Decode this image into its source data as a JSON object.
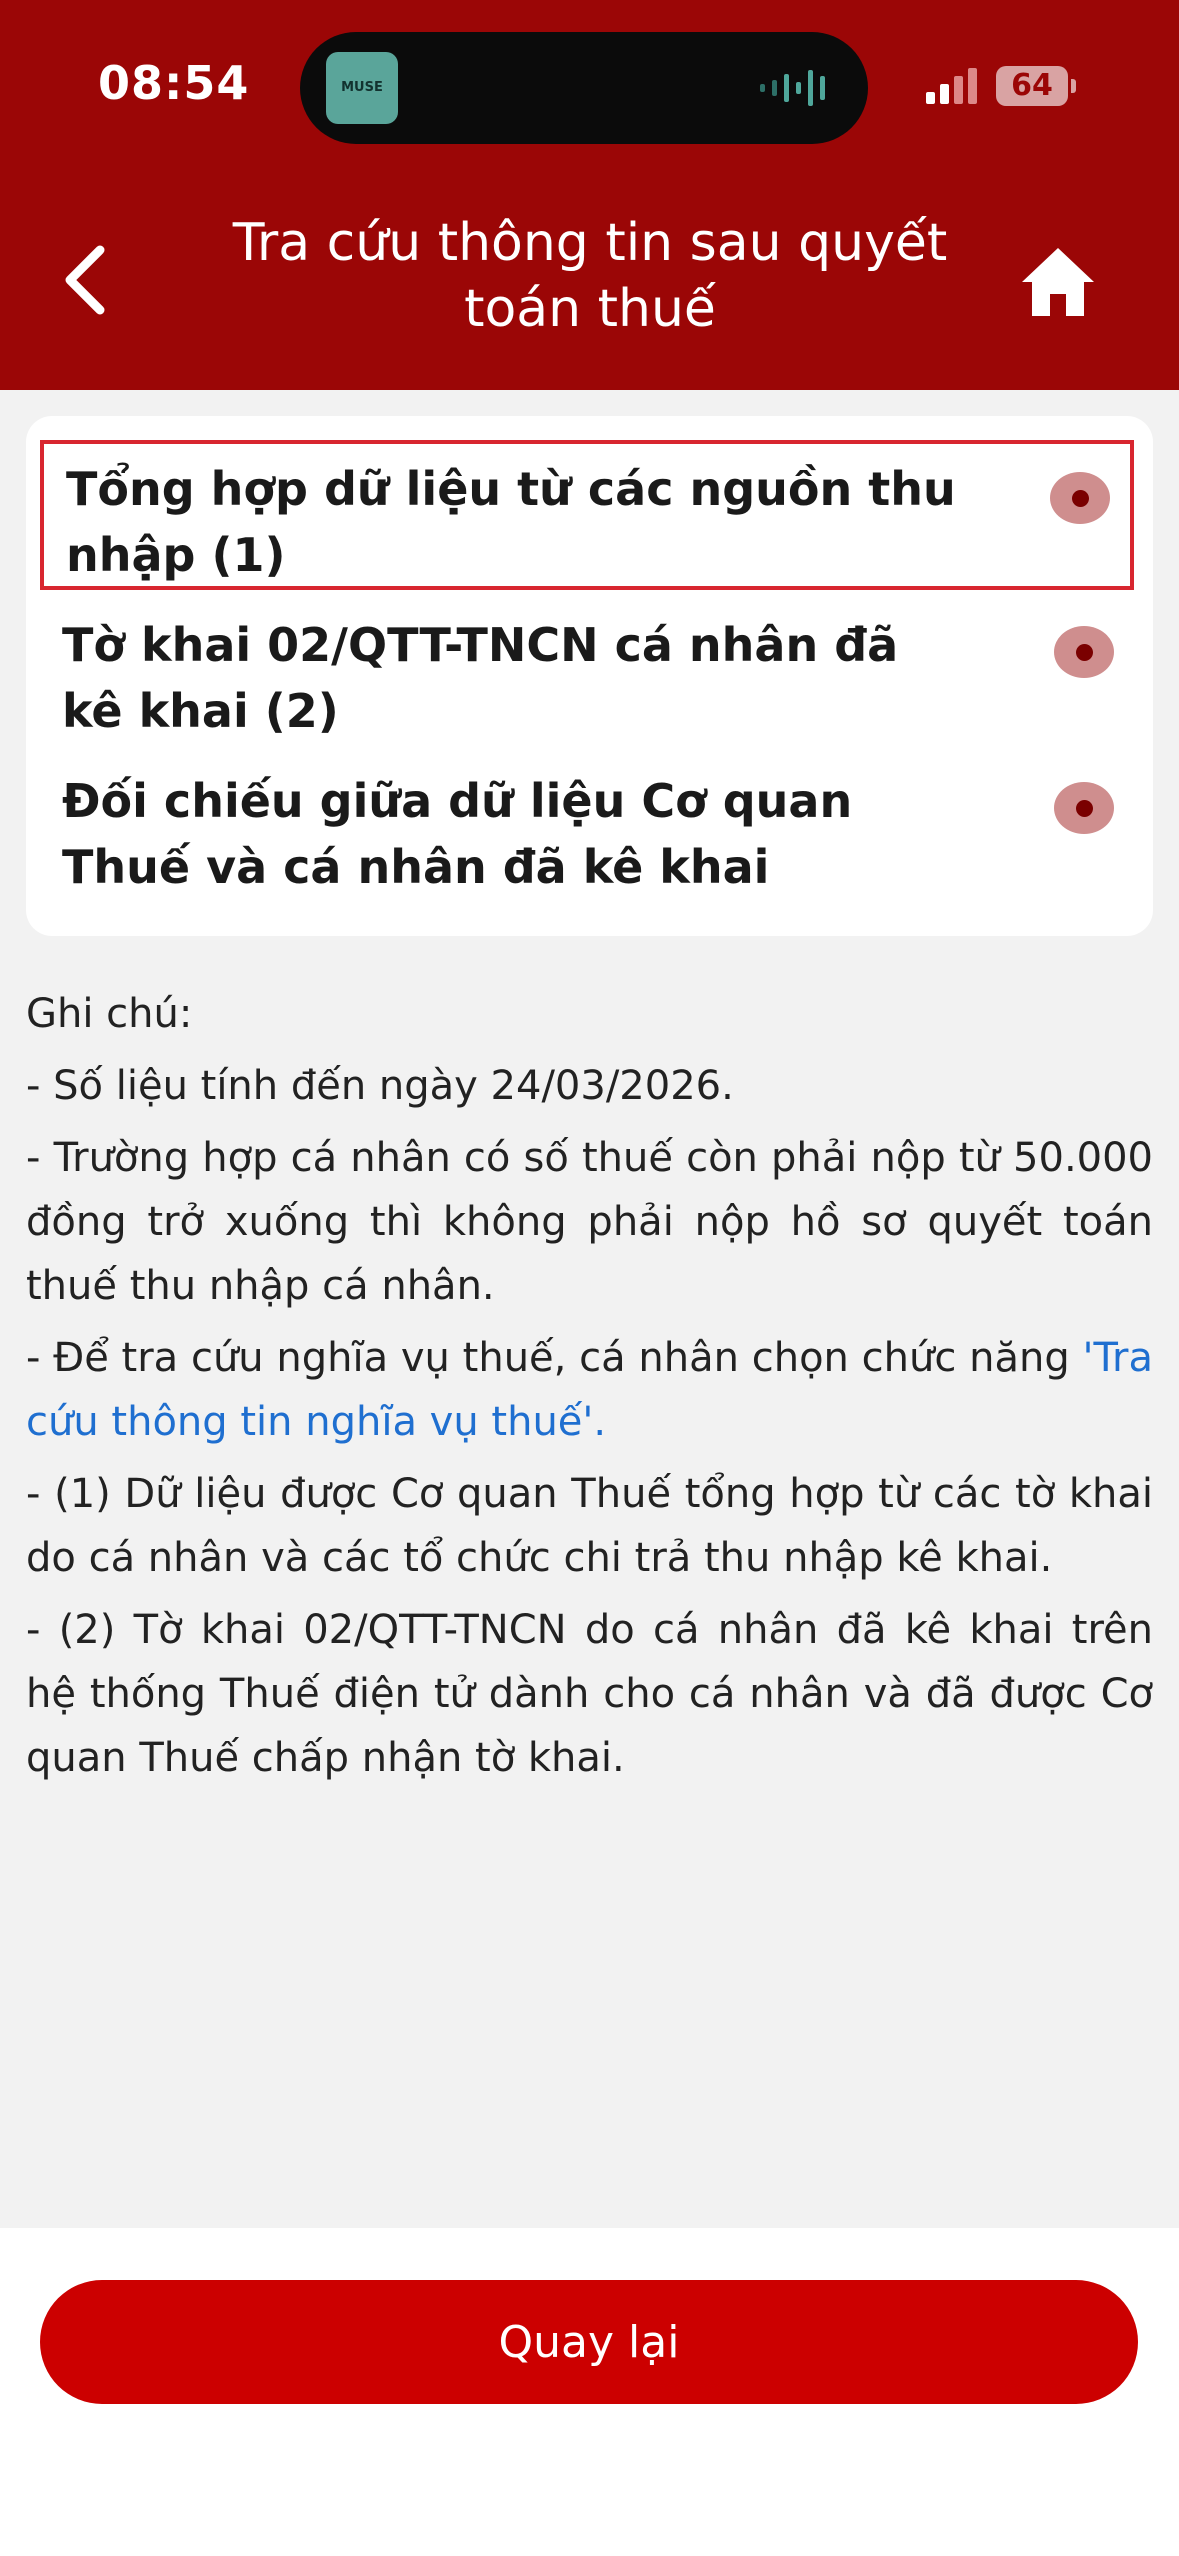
{
  "status_bar": {
    "time": "08:54",
    "now_playing_art_text": "MUSE",
    "battery": "64"
  },
  "header": {
    "title": "Tra cứu thông tin sau quyết toán thuế"
  },
  "options": [
    {
      "label": "Tổng hợp dữ liệu từ các nguồn thu nhập (1)",
      "selected": true
    },
    {
      "label": "Tờ khai 02/QTT-TNCN cá nhân đã kê khai (2)",
      "selected": false
    },
    {
      "label": "Đối chiếu giữa dữ liệu Cơ quan Thuế và cá nhân đã kê khai",
      "selected": false
    }
  ],
  "notes": {
    "heading": "Ghi chú:",
    "line1": "- Số liệu tính đến ngày 24/03/2026.",
    "line2": "- Trường hợp cá nhân có số thuế còn phải nộp từ 50.000 đồng trở xuống thì không phải nộp hồ sơ quyết toán thuế thu nhập cá nhân.",
    "line3_prefix": "- Để tra cứu nghĩa vụ thuế, cá nhân chọn chức năng",
    "line3_link": "'Tra cứu thông tin nghĩa vụ thuế'.",
    "line4": "- (1) Dữ liệu được Cơ quan Thuế tổng hợp từ các tờ khai do cá nhân và các tổ chức chi trả thu nhập kê khai.",
    "line5": "- (2) Tờ khai 02/QTT-TNCN do cá nhân đã kê khai trên hệ thống Thuế điện tử dành cho cá nhân và đã được Cơ quan Thuế chấp nhận tờ khai."
  },
  "footer": {
    "back_label": "Quay lại"
  },
  "colors": {
    "header_bg": "#9b0606",
    "primary_button": "#cc0000",
    "selected_border": "#d8262f",
    "link": "#1f6fd0"
  }
}
